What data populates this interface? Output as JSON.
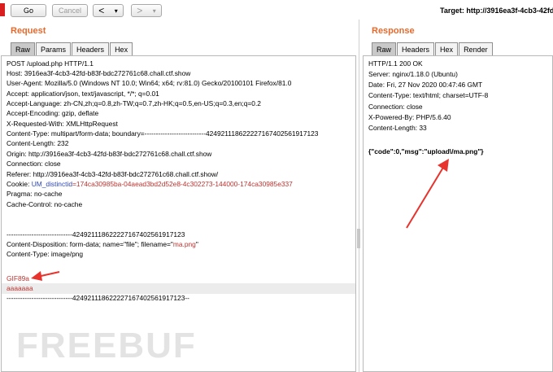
{
  "toolbar": {
    "go_label": "Go",
    "cancel_label": "Cancel",
    "back_glyph": "<",
    "back_menu_glyph": "▾",
    "forward_glyph": ">",
    "forward_menu_glyph": "▾",
    "target": "Target: http://3916ea3f-4cb3-42fd"
  },
  "request": {
    "title": "Request",
    "tabs": [
      "Raw",
      "Params",
      "Headers",
      "Hex"
    ],
    "active_tab": "Raw",
    "lines": [
      "POST /upload.php HTTP/1.1",
      "Host: 3916ea3f-4cb3-42fd-b83f-bdc272761c68.chall.ctf.show",
      "User-Agent: Mozilla/5.0 (Windows NT 10.0; Win64; x64; rv:81.0) Gecko/20100101 Firefox/81.0",
      "Accept: application/json, text/javascript, */*; q=0.01",
      "Accept-Language: zh-CN,zh;q=0.8,zh-TW;q=0.7,zh-HK;q=0.5,en-US;q=0.3,en;q=0.2",
      "Accept-Encoding: gzip, deflate",
      "X-Requested-With: XMLHttpRequest",
      "Content-Type: multipart/form-data; boundary=---------------------------424921118622227167402561917123",
      "Content-Length: 232",
      "Origin: http://3916ea3f-4cb3-42fd-b83f-bdc272761c68.chall.ctf.show",
      "Connection: close",
      "Referer: http://3916ea3f-4cb3-42fd-b83f-bdc272761c68.chall.ctf.show/",
      "Cookie: ",
      "Pragma: no-cache",
      "Cache-Control: no-cache",
      "",
      "-----------------------------424921118622227167402561917123",
      "Content-Disposition: form-data; name=\"file\"; filename=\"",
      "Content-Type: image/png",
      "",
      "GIF89a",
      "aaaaaaa",
      "-----------------------------424921118622227167402561917123--"
    ],
    "cookie_name": "UM_distinctid",
    "cookie_value": "=174ca30985ba-04aead3bd2d52e8-4c302273-144000-174ca30985e337",
    "filename_value": "ma.png",
    "filename_close": "\""
  },
  "response": {
    "title": "Response",
    "tabs": [
      "Raw",
      "Headers",
      "Hex",
      "Render"
    ],
    "active_tab": "Raw",
    "lines": [
      "HTTP/1.1 200 OK",
      "Server: nginx/1.18.0 (Ubuntu)",
      "Date: Fri, 27 Nov 2020 00:47:46 GMT",
      "Content-Type: text/html; charset=UTF-8",
      "Connection: close",
      "X-Powered-By: PHP/5.6.40",
      "Content-Length: 33",
      "",
      "{\"code\":0,\"msg\":\"upload\\/ma.png\"}"
    ]
  },
  "watermark": "FREEBUF",
  "colors": {
    "section_title": "#e8692b",
    "highlight_red": "#c0312d",
    "cookie_blue": "#2c48b8",
    "annotation_arrow": "#e8322c"
  }
}
